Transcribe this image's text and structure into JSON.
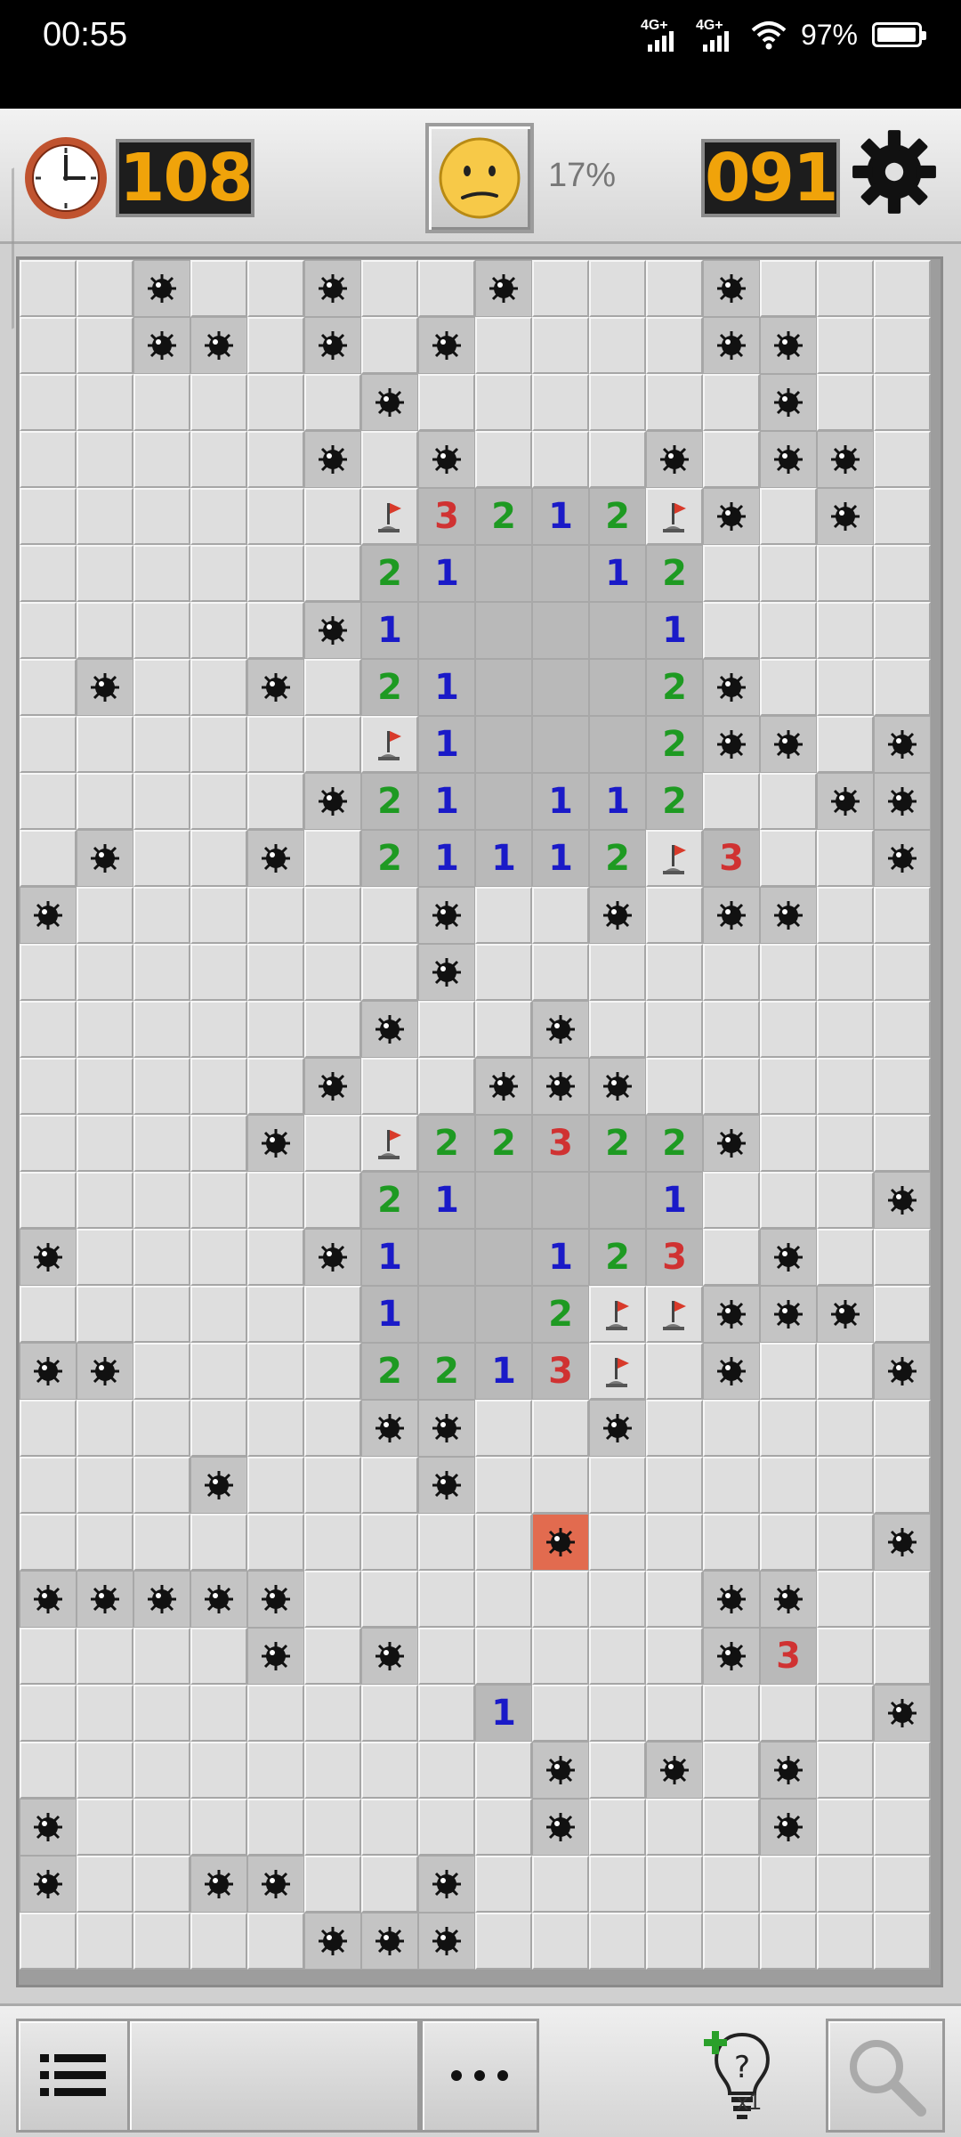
{
  "status_bar": {
    "time": "00:55",
    "network1": "4G+",
    "network2": "4G+",
    "battery": "97%",
    "battery_level": 0.97
  },
  "header": {
    "timer_value": "108",
    "face": "neutral-face",
    "progress": "17%",
    "mines_remaining": "091",
    "icons": [
      "clock-icon",
      "gear-icon"
    ]
  },
  "board": {
    "cols": 16,
    "rows": 30,
    "legend": "u=unopened, o=opened empty, m=mine, x=exploded mine, f=flag, 1-3=number",
    "grid": [
      "uumuumuumuuumuuu",
      "uummumumuuuummuu",
      "uuuuuumuuuuuumuu",
      "uuuuumumuuumummu",
      "uuuuuuf3212fmumu",
      "uuuuuu21oo12uuuu",
      "uuuuum1oooo1uuuu",
      "umuumu21ooo2muuu",
      "uuuuuuf1ooo2mmum",
      "uuuuum21o112uumm",
      "umuumu21112f3uum",
      "muuuuuumuumummuu",
      "uuuuuuumuuuuuuuu",
      "uuuuuumuumuuuuuu",
      "uuuuumuummmuuuuu",
      "uuuumuf22322muuu",
      "uuuuuu21ooo1uuum",
      "muuuum1oo123umuu",
      "uuuuuu1oo2ffmmmu",
      "mmuuuu2213fumuum",
      "uuuuuummuumuuuuu",
      "uuumuuumuuuuuuuu",
      "uuuuuuuuuxuuuuum",
      "mmmmmuuuuuuummuu",
      "uuuumumuuuuum3uu",
      "uuuuuuuu1uuuuuum",
      "uuuuuuuuumumumuu",
      "muuuuuuuumuuumuu",
      "muummuumuuuuuuuu",
      "uuuuummmuuuuuuuu"
    ]
  },
  "bottom_bar": {
    "menu_icon": "list-icon",
    "more_icon": "more-icon",
    "hint_icon": "hint-bulb-icon",
    "hint_count": "x1",
    "search_icon": "magnifier-icon"
  },
  "colors": {
    "n1": "#1a1ac8",
    "n2": "#1e9a22",
    "n3": "#d03232",
    "exploded": "#e26b4f",
    "counter_text": "#f0a30a"
  }
}
